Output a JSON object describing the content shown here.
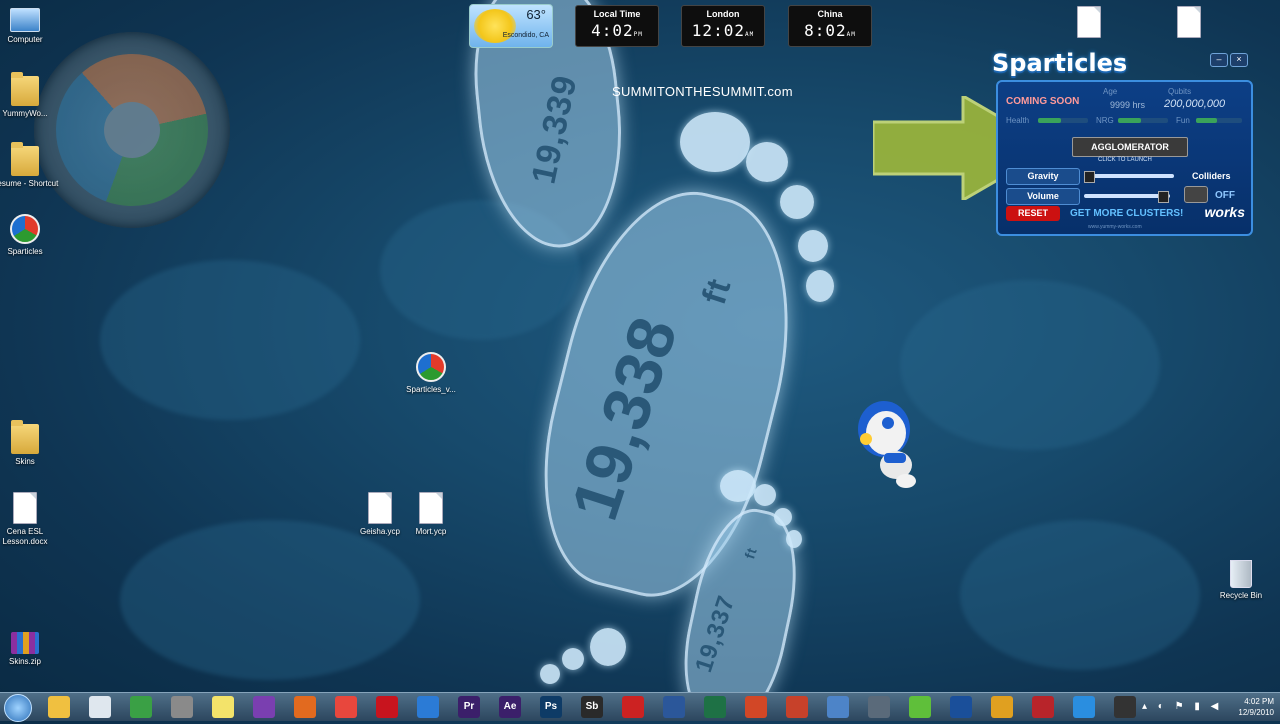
{
  "desktop": {
    "left_icons": [
      {
        "label": "Computer"
      },
      {
        "label": "YummyWo..."
      },
      {
        "label": "Resume - Shortcut"
      },
      {
        "label": "Sparticles"
      },
      {
        "label": "Skins"
      },
      {
        "label": "Cena ESL Lesson.docx"
      },
      {
        "label": "Skins.zip"
      }
    ],
    "middle_icons": [
      {
        "label": "Sparticles_v..."
      },
      {
        "label": "Geisha.ycp"
      },
      {
        "label": "Mort.ycp"
      }
    ],
    "recycle_bin": "Recycle Bin"
  },
  "wallpaper": {
    "site": "SUMMITONTHESUMMIT.com",
    "top_foot": "19,339",
    "big_foot_number": "19,338",
    "big_foot_unit": "ft",
    "small_foot_number": "19,337",
    "small_foot_unit": "ft"
  },
  "weather": {
    "temp": "63°",
    "location": "Escondido, CA"
  },
  "clocks": [
    {
      "label": "Local Time",
      "time": "4:02",
      "ampm": "PM"
    },
    {
      "label": "London",
      "time": "12:02",
      "ampm": "AM"
    },
    {
      "label": "China",
      "time": "8:02",
      "ampm": "AM"
    }
  ],
  "sparticles": {
    "title": "Sparticles",
    "minimize": "–",
    "close": "×",
    "coming_soon": "COMING SOON",
    "age_label": "Age",
    "age_value": "9999 hrs",
    "qubits_label": "Qubits",
    "qubits_value": "200,000,000",
    "health_label": "Health",
    "nrg_label": "NRG",
    "fun_label": "Fun",
    "health_level": 0.45,
    "nrg_level": 0.45,
    "fun_level": 0.45,
    "agglomerator": "AGGLOMERATOR",
    "click_to_launch": "CLICK TO LAUNCH",
    "gravity": "Gravity",
    "colliders": "Colliders",
    "volume": "Volume",
    "off": "OFF",
    "reset": "RESET",
    "get_more": "GET MORE CLUSTERS!",
    "brand": "works",
    "site": "www.yummy-works.com"
  },
  "taskbar": {
    "apps": [
      "Explorer",
      "Docs",
      "Chrome",
      "Tools",
      "Notes",
      "Globe",
      "Firefox",
      "Chrome",
      "Opera",
      "IE",
      "Pr",
      "Ae",
      "Ps",
      "Sb",
      "Video",
      "Word",
      "Excel",
      "PowerPoint",
      "Game",
      "Pen",
      "Files",
      "Type",
      "Mail",
      "Folder",
      "FileZilla",
      "Sync",
      "Cam"
    ],
    "time": "4:02 PM",
    "date": "12/9/2010"
  }
}
